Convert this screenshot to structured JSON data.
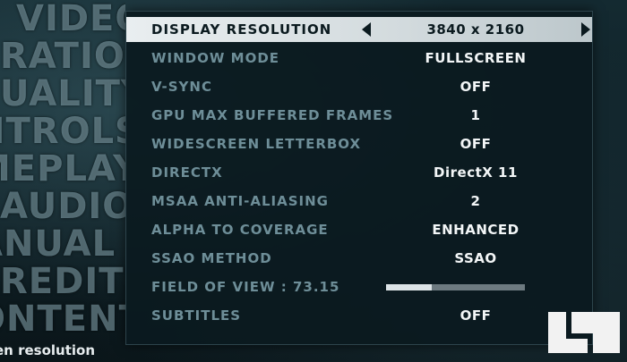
{
  "side_menu": [
    "VIDEO",
    "RATION",
    "UALITY",
    "NTROLS",
    "MEPLAY",
    "AUDIO",
    "ANUAL",
    "REDITS",
    "ONTENT"
  ],
  "settings": [
    {
      "label": "DISPLAY RESOLUTION",
      "value": "3840 x 2160"
    },
    {
      "label": "WINDOW MODE",
      "value": "FULLSCREEN"
    },
    {
      "label": "V-SYNC",
      "value": "OFF"
    },
    {
      "label": "GPU MAX BUFFERED FRAMES",
      "value": "1"
    },
    {
      "label": "WIDESCREEN LETTERBOX",
      "value": "OFF"
    },
    {
      "label": "DIRECTX",
      "value": "DirectX 11"
    },
    {
      "label": "MSAA ANTI-ALIASING",
      "value": "2"
    },
    {
      "label": "ALPHA TO COVERAGE",
      "value": "ENHANCED"
    },
    {
      "label": "SSAO METHOD",
      "value": "SSAO"
    },
    {
      "label": "FIELD OF VIEW : 73.15",
      "slider_fraction": 0.33
    },
    {
      "label": "SUBTITLES",
      "value": "OFF"
    }
  ],
  "hint_text": "en resolution",
  "colors": {
    "selected_row": "#e9eef0",
    "label": "#6e8e98",
    "value": "#f3f6f7",
    "panel": "#0b1a1f"
  }
}
